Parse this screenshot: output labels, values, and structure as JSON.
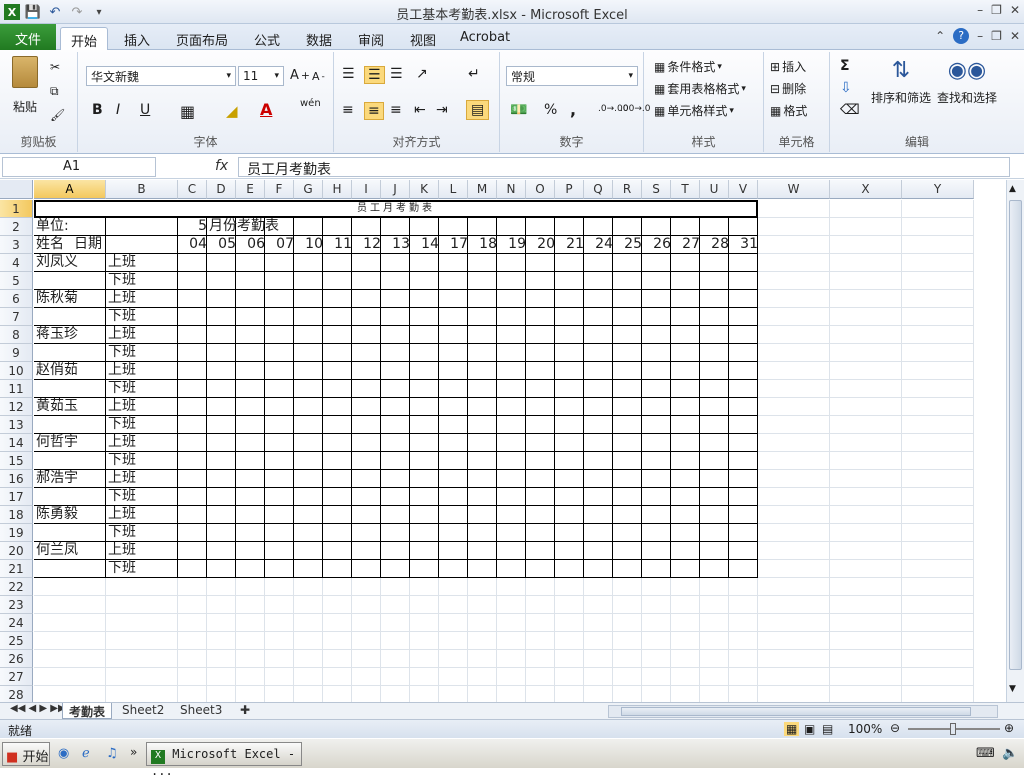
{
  "window": {
    "title": "员工基本考勤表.xlsx - Microsoft Excel"
  },
  "qat": {
    "save_icon": "save-icon",
    "undo_icon": "undo-icon",
    "redo_icon": "redo-icon",
    "customize_icon": "customize-qat-icon"
  },
  "tabs": [
    {
      "label": "文件"
    },
    {
      "label": "开始"
    },
    {
      "label": "插入"
    },
    {
      "label": "页面布局"
    },
    {
      "label": "公式"
    },
    {
      "label": "数据"
    },
    {
      "label": "审阅"
    },
    {
      "label": "视图"
    },
    {
      "label": "Acrobat"
    }
  ],
  "ribbon": {
    "clipboard": {
      "paste": "粘贴",
      "label": "剪贴板"
    },
    "font": {
      "name": "华文新魏",
      "size": "11",
      "bold": "B",
      "italic": "I",
      "underline": "U",
      "label": "字体",
      "phonetic": "wén"
    },
    "alignment": {
      "label": "对齐方式"
    },
    "number": {
      "format": "常规",
      "percent": "%",
      "comma": ",",
      "label": "数字",
      "inc_decimal": ".0→.00",
      "dec_decimal": ".00→.0"
    },
    "styles": {
      "conditional": "条件格式",
      "table": "套用表格格式",
      "cell": "单元格样式",
      "label": "样式"
    },
    "cells": {
      "insert": "插入",
      "delete": "删除",
      "format": "格式",
      "label": "单元格"
    },
    "editing": {
      "sigma": "Σ",
      "sort": "排序和筛选",
      "find": "查找和选择",
      "label": "编辑"
    }
  },
  "formula_bar": {
    "name_box": "A1",
    "fx": "fx",
    "content": "员工月考勤表"
  },
  "columns": [
    "A",
    "B",
    "C",
    "D",
    "E",
    "F",
    "G",
    "H",
    "I",
    "J",
    "K",
    "L",
    "M",
    "N",
    "O",
    "P",
    "Q",
    "R",
    "S",
    "T",
    "U",
    "V",
    "W",
    "X",
    "Y"
  ],
  "rows": [
    "1",
    "2",
    "3",
    "4",
    "5",
    "6",
    "7",
    "8",
    "9",
    "10",
    "11",
    "12",
    "13",
    "14",
    "15",
    "16",
    "17",
    "18",
    "19",
    "20",
    "21",
    "22",
    "23",
    "24",
    "25",
    "26",
    "27",
    "28"
  ],
  "sheet": {
    "title": "员工月考勤表",
    "unit_label": "单位:",
    "month_value": "5",
    "month_label": "月份考勤表",
    "name_header": "姓名",
    "date_header": "日期",
    "dates": [
      "04",
      "05",
      "06",
      "07",
      "10",
      "11",
      "12",
      "13",
      "14",
      "17",
      "18",
      "19",
      "20",
      "21",
      "24",
      "25",
      "26",
      "27",
      "28",
      "31"
    ],
    "on_duty": "上班",
    "off_duty": "下班",
    "employees": [
      "刘凤义",
      "陈秋菊",
      "蒋玉珍",
      "赵俏茹",
      "黄茹玉",
      "何哲宇",
      "郝浩宇",
      "陈勇毅",
      "何兰凤"
    ]
  },
  "sheet_tabs": [
    {
      "label": "考勤表"
    },
    {
      "label": "Sheet2"
    },
    {
      "label": "Sheet3"
    }
  ],
  "status": {
    "ready": "就绪",
    "zoom": "100%"
  },
  "taskbar": {
    "start": "开始",
    "task": "Microsoft Excel - ..."
  }
}
